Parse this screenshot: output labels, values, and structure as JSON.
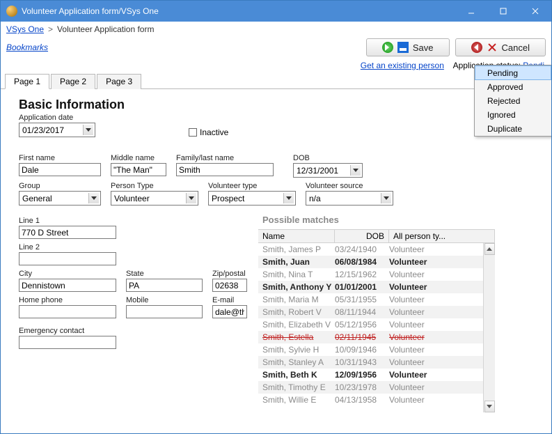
{
  "window": {
    "title": "Volunteer Application form/VSys One"
  },
  "breadcrumb": {
    "root": "VSys One",
    "sep": ">",
    "current": "Volunteer Application form"
  },
  "toolbar": {
    "bookmarks": "Bookmarks",
    "save": "Save",
    "cancel": "Cancel"
  },
  "status": {
    "getExisting": "Get an existing person",
    "appStatusLabel": "Application status:",
    "appStatusValue": "Pendi"
  },
  "tabs": [
    "Page 1",
    "Page 2",
    "Page 3"
  ],
  "section": "Basic Information",
  "labels": {
    "appDate": "Application date",
    "inactive": "Inactive",
    "first": "First name",
    "middle": "Middle name",
    "family": "Family/last name",
    "dob": "DOB",
    "group": "Group",
    "ptype": "Person Type",
    "vtype": "Volunteer type",
    "vsource": "Volunteer source",
    "line1": "Line 1",
    "line2": "Line 2",
    "city": "City",
    "state": "State",
    "zip": "Zip/postal",
    "homePhone": "Home phone",
    "mobile": "Mobile",
    "email": "E-mail",
    "emergency": "Emergency contact"
  },
  "values": {
    "appDate": "01/23/2017",
    "first": "Dale",
    "middle": "\"The Man\"",
    "family": "Smith",
    "dob": "12/31/2001",
    "group": "General",
    "ptype": "Volunteer",
    "vtype": "Prospect",
    "vsource": "n/a",
    "line1": "770 D Street",
    "line2": "",
    "city": "Dennistown",
    "state": "PA",
    "zip": "02638",
    "homePhone": "",
    "mobile": "",
    "email": "dale@ther",
    "emergency": ""
  },
  "matches": {
    "title": "Possible matches",
    "cols": [
      "Name",
      "DOB",
      "All person ty..."
    ],
    "rows": [
      {
        "n": "Smith, James P",
        "d": "03/24/1940",
        "t": "Volunteer",
        "style": ""
      },
      {
        "n": "Smith, Juan",
        "d": "06/08/1984",
        "t": "Volunteer",
        "style": "dark alt"
      },
      {
        "n": "Smith, Nina T",
        "d": "12/15/1962",
        "t": "Volunteer",
        "style": ""
      },
      {
        "n": "Smith, Anthony Y",
        "d": "01/01/2001",
        "t": "Volunteer",
        "style": "dark alt"
      },
      {
        "n": "Smith, Maria M",
        "d": "05/31/1955",
        "t": "Volunteer",
        "style": ""
      },
      {
        "n": "Smith, Robert V",
        "d": "08/11/1944",
        "t": "Volunteer",
        "style": "alt"
      },
      {
        "n": "Smith, Elizabeth V",
        "d": "05/12/1956",
        "t": "Volunteer",
        "style": ""
      },
      {
        "n": "Smith, Estella",
        "d": "02/11/1945",
        "t": "Volunteer",
        "style": "strike alt"
      },
      {
        "n": "Smith, Sylvie H",
        "d": "10/09/1946",
        "t": "Volunteer",
        "style": ""
      },
      {
        "n": "Smith, Stanley A",
        "d": "10/31/1943",
        "t": "Volunteer",
        "style": "alt"
      },
      {
        "n": "Smith, Beth K",
        "d": "12/09/1956",
        "t": "Volunteer",
        "style": "dark"
      },
      {
        "n": "Smith, Timothy E",
        "d": "10/23/1978",
        "t": "Volunteer",
        "style": "alt"
      },
      {
        "n": "Smith, Willie E",
        "d": "04/13/1958",
        "t": "Volunteer",
        "style": ""
      }
    ]
  },
  "popup": [
    "Pending",
    "Approved",
    "Rejected",
    "Ignored",
    "Duplicate"
  ]
}
